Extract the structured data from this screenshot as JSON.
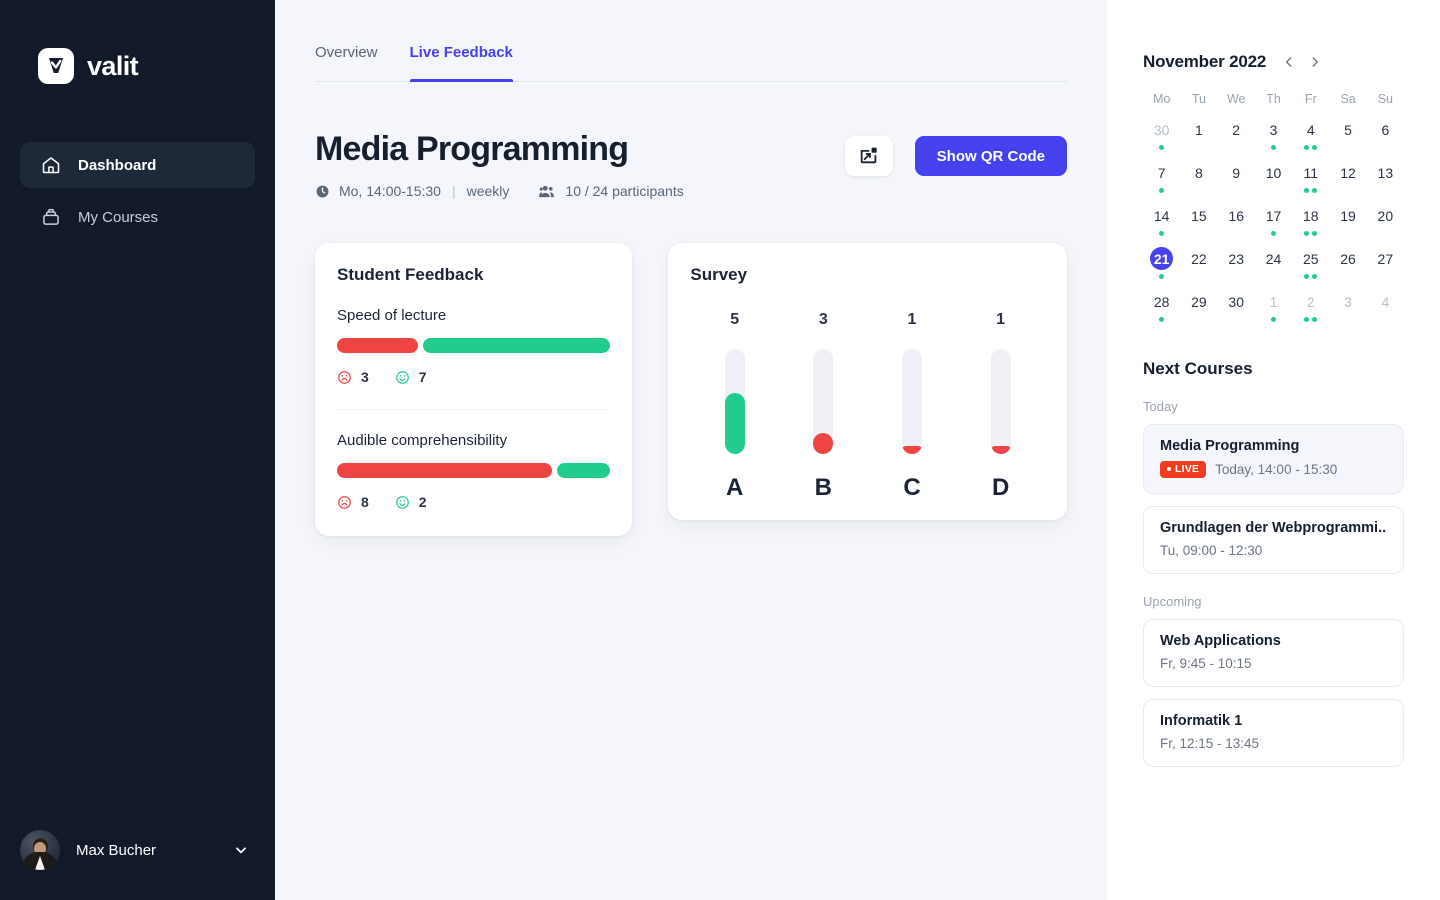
{
  "brand": {
    "name": "valit",
    "mark_icon": "valit-checkmark-logo"
  },
  "sidebar": {
    "items": [
      {
        "label": "Dashboard",
        "icon": "home-icon",
        "active": true
      },
      {
        "label": "My Courses",
        "icon": "briefcase-icon",
        "active": false
      }
    ],
    "user": {
      "name": "Max Bucher",
      "caret_icon": "chevron-down-icon",
      "avatar_icon": "user-avatar"
    }
  },
  "tabs": [
    {
      "label": "Overview",
      "active": false
    },
    {
      "label": "Live Feedback",
      "active": true
    }
  ],
  "page": {
    "title": "Media Programming",
    "schedule_icon": "clock-icon",
    "schedule": "Mo, 14:00-15:30",
    "schedule_sep": "|",
    "recurrence": "weekly",
    "participants_icon": "people-icon",
    "participants": "10 / 24 participants"
  },
  "actions": {
    "present_icon": "present-screen-icon",
    "qr_label": "Show QR Code"
  },
  "feedback_card": {
    "title": "Student Feedback",
    "items": [
      {
        "label": "Speed of lecture",
        "negative": 3,
        "positive": 7,
        "negative_pct": 30,
        "positive_pct": 70
      },
      {
        "label": "Audible comprehensibility",
        "negative": 8,
        "positive": 2,
        "negative_pct": 80,
        "positive_pct": 20
      }
    ],
    "negative_icon": "frowning-face-icon",
    "positive_icon": "smiling-face-icon"
  },
  "survey_card": {
    "title": "Survey"
  },
  "chart_data": {
    "type": "bar",
    "title": "Survey",
    "categories": [
      "A",
      "B",
      "C",
      "D"
    ],
    "values": [
      5,
      3,
      1,
      1
    ],
    "colors": [
      "#22cc8e",
      "#ef4444",
      "#ef4444",
      "#ef4444"
    ],
    "fill_pct": [
      58,
      20,
      8,
      8
    ],
    "orientation": "vertical",
    "xlabel": "",
    "ylabel": "",
    "ylim": [
      0,
      8
    ],
    "grid": false,
    "legend": "none",
    "note": "A is the correct answer (green); B, C, D incorrect (red). Labels above bars are response counts."
  },
  "calendar": {
    "month": "November 2022",
    "prev_icon": "chevron-left-icon",
    "next_icon": "chevron-right-icon",
    "dow": [
      "Mo",
      "Tu",
      "We",
      "Th",
      "Fr",
      "Sa",
      "Su"
    ],
    "days": [
      {
        "n": "30",
        "muted": true,
        "today": false,
        "dots": 1
      },
      {
        "n": "1",
        "muted": false,
        "today": false,
        "dots": 0
      },
      {
        "n": "2",
        "muted": false,
        "today": false,
        "dots": 0
      },
      {
        "n": "3",
        "muted": false,
        "today": false,
        "dots": 1
      },
      {
        "n": "4",
        "muted": false,
        "today": false,
        "dots": 2
      },
      {
        "n": "5",
        "muted": false,
        "today": false,
        "dots": 0
      },
      {
        "n": "6",
        "muted": false,
        "today": false,
        "dots": 0
      },
      {
        "n": "7",
        "muted": false,
        "today": false,
        "dots": 1
      },
      {
        "n": "8",
        "muted": false,
        "today": false,
        "dots": 0
      },
      {
        "n": "9",
        "muted": false,
        "today": false,
        "dots": 0
      },
      {
        "n": "10",
        "muted": false,
        "today": false,
        "dots": 0
      },
      {
        "n": "11",
        "muted": false,
        "today": false,
        "dots": 2
      },
      {
        "n": "12",
        "muted": false,
        "today": false,
        "dots": 0
      },
      {
        "n": "13",
        "muted": false,
        "today": false,
        "dots": 0
      },
      {
        "n": "14",
        "muted": false,
        "today": false,
        "dots": 1
      },
      {
        "n": "15",
        "muted": false,
        "today": false,
        "dots": 0
      },
      {
        "n": "16",
        "muted": false,
        "today": false,
        "dots": 0
      },
      {
        "n": "17",
        "muted": false,
        "today": false,
        "dots": 1
      },
      {
        "n": "18",
        "muted": false,
        "today": false,
        "dots": 2
      },
      {
        "n": "19",
        "muted": false,
        "today": false,
        "dots": 0
      },
      {
        "n": "20",
        "muted": false,
        "today": false,
        "dots": 0
      },
      {
        "n": "21",
        "muted": false,
        "today": true,
        "dots": 1
      },
      {
        "n": "22",
        "muted": false,
        "today": false,
        "dots": 0
      },
      {
        "n": "23",
        "muted": false,
        "today": false,
        "dots": 0
      },
      {
        "n": "24",
        "muted": false,
        "today": false,
        "dots": 0
      },
      {
        "n": "25",
        "muted": false,
        "today": false,
        "dots": 2
      },
      {
        "n": "26",
        "muted": false,
        "today": false,
        "dots": 0
      },
      {
        "n": "27",
        "muted": false,
        "today": false,
        "dots": 0
      },
      {
        "n": "28",
        "muted": false,
        "today": false,
        "dots": 1
      },
      {
        "n": "29",
        "muted": false,
        "today": false,
        "dots": 0
      },
      {
        "n": "30",
        "muted": false,
        "today": false,
        "dots": 0
      },
      {
        "n": "1",
        "muted": true,
        "today": false,
        "dots": 1
      },
      {
        "n": "2",
        "muted": true,
        "today": false,
        "dots": 2
      },
      {
        "n": "3",
        "muted": true,
        "today": false,
        "dots": 0
      },
      {
        "n": "4",
        "muted": true,
        "today": false,
        "dots": 0
      }
    ]
  },
  "next_courses": {
    "title": "Next Courses",
    "groups": [
      {
        "label": "Today",
        "courses": [
          {
            "name": "Media Programming",
            "badge": "LIVE",
            "time": "Today, 14:00 - 15:30",
            "highlight": true
          },
          {
            "name": "Grundlagen der Webprogrammi...",
            "badge": "",
            "time": "Tu, 09:00 - 12:30",
            "highlight": false
          }
        ]
      },
      {
        "label": "Upcoming",
        "courses": [
          {
            "name": "Web Applications",
            "badge": "",
            "time": "Fr, 9:45 - 10:15",
            "highlight": false
          },
          {
            "name": "Informatik 1",
            "badge": "",
            "time": "Fr, 12:15 - 13:45",
            "highlight": false
          }
        ]
      }
    ]
  },
  "colors": {
    "accent": "#4541ee",
    "positive": "#22cc8e",
    "negative": "#ef4444",
    "live": "#f03c1e",
    "sidebar_bg": "#121a2a",
    "page_bg": "#f4f6fb"
  }
}
